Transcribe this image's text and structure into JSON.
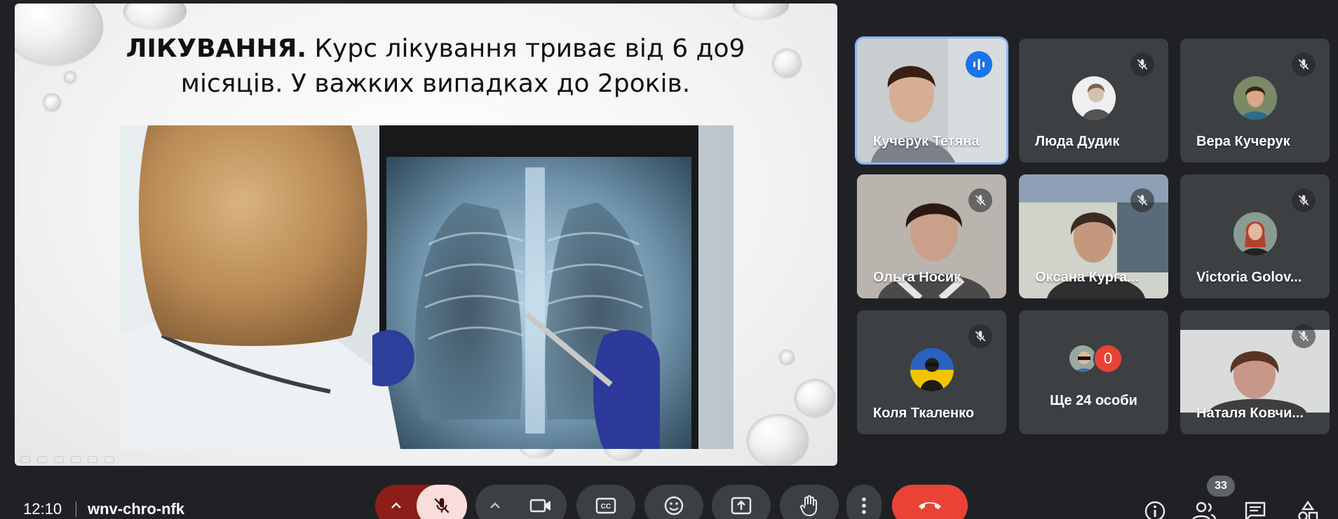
{
  "slide": {
    "title_bold": "ЛІКУВАННЯ.",
    "title_rest": " Курс лікування триває від 6 до9",
    "title_line2": "місяців. У важких випадках до 2років."
  },
  "participants": [
    {
      "name": "Кучерук Тетяна",
      "state": "speaking"
    },
    {
      "name": "Люда Дудик",
      "state": "muted"
    },
    {
      "name": "Вера Кучерук",
      "state": "muted"
    },
    {
      "name": "Ольга Носик",
      "state": "muted"
    },
    {
      "name": "Оксана Курга...",
      "state": "muted"
    },
    {
      "name": "Victoria Golov...",
      "state": "muted"
    },
    {
      "name": "Коля Ткаленко",
      "state": "muted"
    },
    {
      "name": "Наталя Ковчи...",
      "state": "muted"
    }
  ],
  "more_tile": {
    "count": "0",
    "label": "Ще 24 особи"
  },
  "bottom_bar": {
    "time": "12:10",
    "meeting_code": "wnv-chro-nfk",
    "people_count": "33"
  },
  "colors": {
    "background": "#202124",
    "tile": "#3c4043",
    "active_border": "#8ab4f8",
    "end_call": "#ea4335",
    "mic_off_bg": "#f9dedc",
    "mic_off_group": "#8c1d18"
  }
}
